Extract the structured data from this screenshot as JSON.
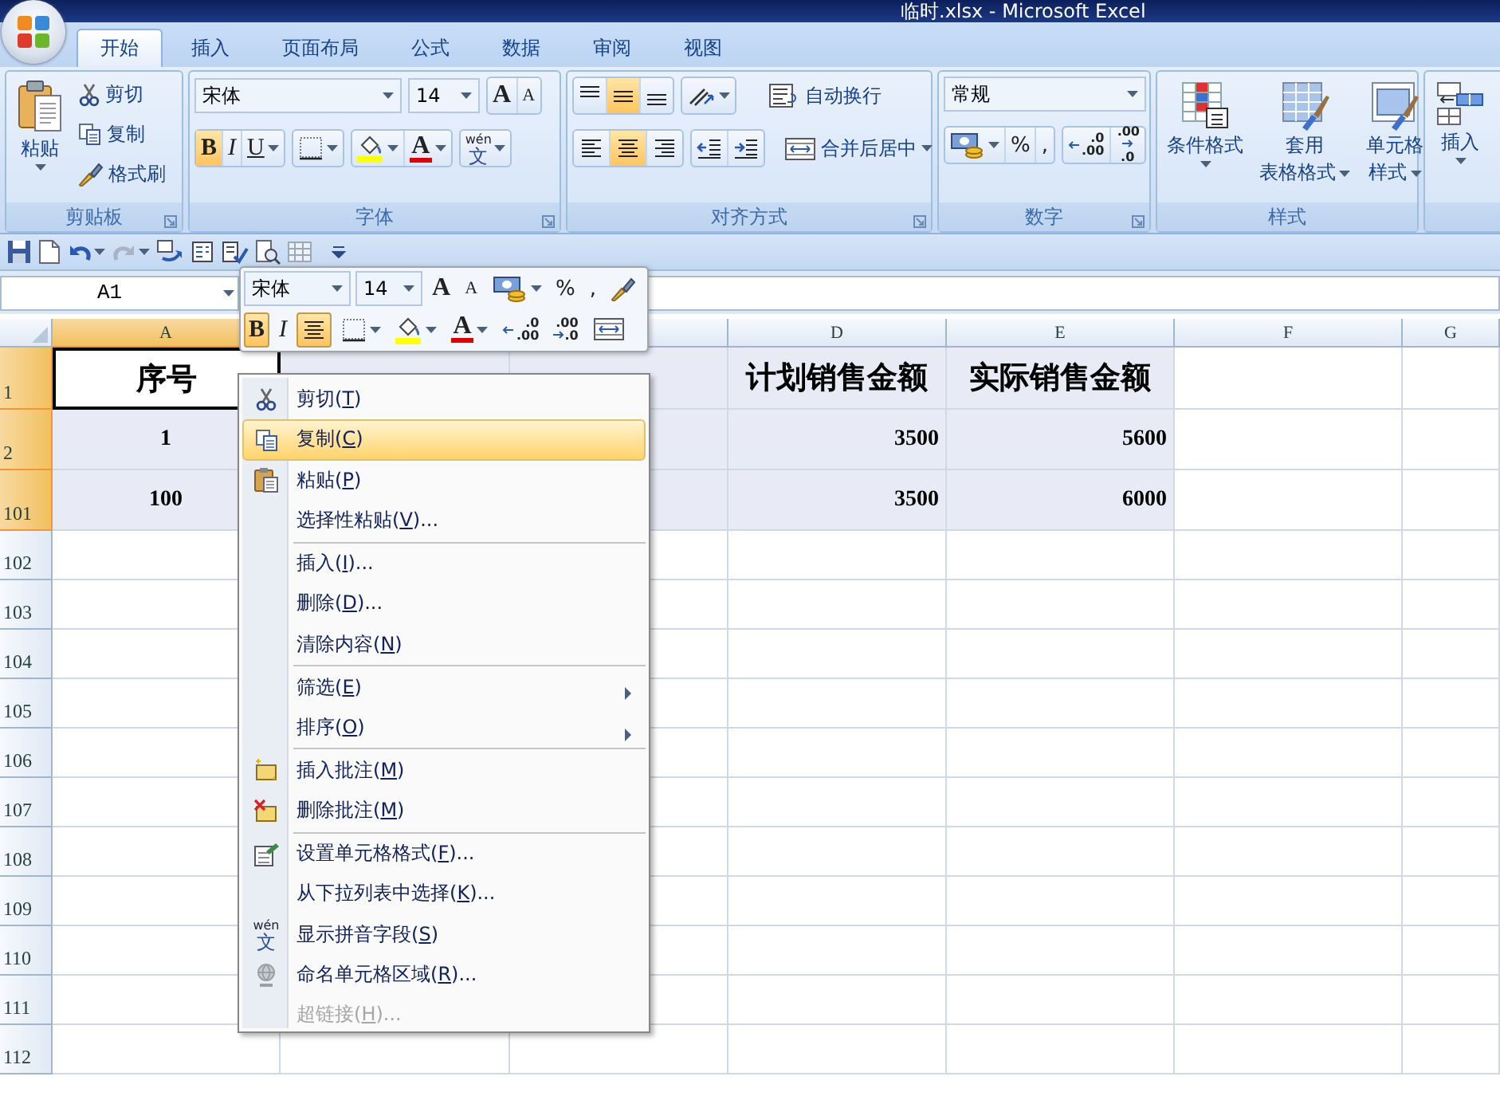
{
  "window": {
    "title": "临时.xlsx - Microsoft Excel"
  },
  "ribbon_tabs": [
    {
      "label": "开始",
      "selected": true
    },
    {
      "label": "插入",
      "selected": false
    },
    {
      "label": "页面布局",
      "selected": false
    },
    {
      "label": "公式",
      "selected": false
    },
    {
      "label": "数据",
      "selected": false
    },
    {
      "label": "审阅",
      "selected": false
    },
    {
      "label": "视图",
      "selected": false
    }
  ],
  "clipboard": {
    "label": "剪贴板",
    "paste": "粘贴",
    "cut": "剪切",
    "copy": "复制",
    "format_painter": "格式刷"
  },
  "font": {
    "label": "字体",
    "font_name": "宋体",
    "font_size": "14",
    "grow": "A",
    "shrink": "A",
    "styles": [
      {
        "glyph": "B",
        "selected": true
      },
      {
        "glyph": "I",
        "selected": false
      },
      {
        "glyph": "U",
        "selected": false
      }
    ],
    "font_color": "A",
    "phonetic": {
      "ruby": "wén",
      "glyph": "文"
    }
  },
  "alignment": {
    "label": "对齐方式",
    "vertical": [
      {
        "selected": false
      },
      {
        "selected": true
      },
      {
        "selected": false
      }
    ],
    "horizontal": [
      {
        "selected": false
      },
      {
        "selected": true
      },
      {
        "selected": false
      }
    ],
    "wrap_text": "自动换行",
    "merge": "合并后居中"
  },
  "number": {
    "label": "数字",
    "format": "常规",
    "percent": "%",
    "comma": ",",
    "decimals": [
      {
        "top": ".0",
        "bottom": ".00"
      },
      {
        "top": ".00",
        "bottom": ".0"
      }
    ]
  },
  "styles": {
    "label": "样式",
    "buttons": [
      {
        "lines": [
          "条件格式"
        ]
      },
      {
        "lines": [
          "套用",
          "表格格式"
        ]
      },
      {
        "lines": [
          "单元格",
          "样式"
        ]
      }
    ]
  },
  "cells": {
    "buttons": [
      {
        "lines": [
          "插入"
        ]
      }
    ]
  },
  "name_box": "A1",
  "mini_toolbar": {
    "font_name": "宋体",
    "font_size": "14",
    "grow": "A",
    "shrink": "A",
    "percent": "%",
    "comma": ",",
    "styles": [
      {
        "glyph": "B",
        "selected": true
      },
      {
        "glyph": "I",
        "selected": false
      }
    ],
    "align_center": {
      "selected": true
    },
    "font_color": "A",
    "decimals": [
      {
        "top": ".0",
        "bottom": ".00"
      },
      {
        "top": ".00",
        "bottom": ".0"
      }
    ]
  },
  "columns": [
    {
      "kind": "lettered",
      "label": "A",
      "selected": true
    },
    {
      "kind": "blank"
    },
    {
      "kind": "blank",
      "selected": false
    },
    {
      "kind": "lettered",
      "label": "D",
      "selected": false
    },
    {
      "kind": "lettered",
      "label": "E",
      "selected": false
    },
    {
      "kind": "lettered",
      "label": "F",
      "selected": false
    },
    {
      "kind": "lettered",
      "label": "G",
      "selected": false
    }
  ],
  "rows": [
    {
      "header": "1",
      "selected": true,
      "kind": "heading",
      "cells": [
        {
          "text": "序号",
          "active": true
        },
        {
          "active": false
        },
        {
          "active": false
        },
        {
          "text": "计划销售金额",
          "active": false
        },
        {
          "text": "实际销售金额",
          "active": false
        }
      ]
    },
    {
      "header": "2",
      "selected": true,
      "kind": "data",
      "cells": [
        {
          "text": "1",
          "active": false
        },
        null,
        {
          "active": false
        },
        {
          "text": "3500",
          "active": false
        },
        {
          "text": "5600",
          "active": false
        }
      ]
    },
    {
      "header": "101",
      "selected": true,
      "kind": "data",
      "cells": [
        {
          "text": "100",
          "active": false
        },
        null,
        {
          "active": false
        },
        {
          "text": "3500",
          "active": false
        },
        {
          "text": "6000",
          "active": false
        }
      ]
    },
    {
      "header": "102",
      "selected": false,
      "kind": "empty"
    },
    {
      "header": "103",
      "selected": false,
      "kind": "empty"
    },
    {
      "header": "104",
      "selected": false,
      "kind": "empty"
    },
    {
      "header": "105",
      "selected": false,
      "kind": "empty"
    },
    {
      "header": "106",
      "selected": false,
      "kind": "empty"
    },
    {
      "header": "107",
      "selected": false,
      "kind": "empty"
    },
    {
      "header": "108",
      "selected": false,
      "kind": "empty"
    },
    {
      "header": "109",
      "selected": false,
      "kind": "empty"
    },
    {
      "header": "110",
      "selected": false,
      "kind": "empty"
    },
    {
      "header": "111",
      "selected": false,
      "kind": "empty"
    },
    {
      "header": "112",
      "selected": false,
      "kind": "empty"
    }
  ],
  "context_menu": {
    "groups": [
      [
        {
          "label": "剪切(",
          "key": "T",
          "after": ")",
          "selected": false,
          "disabled": false,
          "submenu": false
        },
        {
          "label": "复制(",
          "key": "C",
          "after": ")",
          "selected": true,
          "disabled": false,
          "submenu": false
        },
        {
          "label": "粘贴(",
          "key": "P",
          "after": ")",
          "selected": false,
          "disabled": false,
          "submenu": false
        },
        {
          "label": "选择性粘贴(",
          "key": "V",
          "after": ")...",
          "selected": false,
          "disabled": false,
          "submenu": false
        }
      ],
      [
        {
          "label": "插入(",
          "key": "I",
          "after": ")...",
          "selected": false,
          "disabled": false,
          "submenu": false
        },
        {
          "label": "删除(",
          "key": "D",
          "after": ")...",
          "selected": false,
          "disabled": false,
          "submenu": false
        },
        {
          "label": "清除内容(",
          "key": "N",
          "after": ")",
          "selected": false,
          "disabled": false,
          "submenu": false
        }
      ],
      [
        {
          "label": "筛选(",
          "key": "E",
          "after": ")",
          "selected": false,
          "disabled": false,
          "submenu": true
        },
        {
          "label": "排序(",
          "key": "O",
          "after": ")",
          "selected": false,
          "disabled": false,
          "submenu": true
        }
      ],
      [
        {
          "label": "插入批注(",
          "key": "M",
          "after": ")",
          "selected": false,
          "disabled": false,
          "submenu": false
        },
        {
          "label": "删除批注(",
          "key": "M",
          "after": ")",
          "selected": false,
          "disabled": false,
          "submenu": false
        }
      ],
      [
        {
          "label": "设置单元格格式(",
          "key": "F",
          "after": ")...",
          "selected": false,
          "disabled": false,
          "submenu": false
        },
        {
          "label": "从下拉列表中选择(",
          "key": "K",
          "after": ")...",
          "selected": false,
          "disabled": false,
          "submenu": false
        },
        {
          "label": "显示拼音字段(",
          "key": "S",
          "after": ")",
          "selected": false,
          "disabled": false,
          "submenu": false,
          "icon_ruby": "wén",
          "icon_glyph": "文"
        },
        {
          "label": "命名单元格区域(",
          "key": "R",
          "after": ")...",
          "selected": false,
          "disabled": false,
          "submenu": false
        },
        {
          "label": "超链接(",
          "key": "H",
          "after": ")...",
          "selected": false,
          "disabled": true,
          "submenu": false
        }
      ]
    ]
  }
}
